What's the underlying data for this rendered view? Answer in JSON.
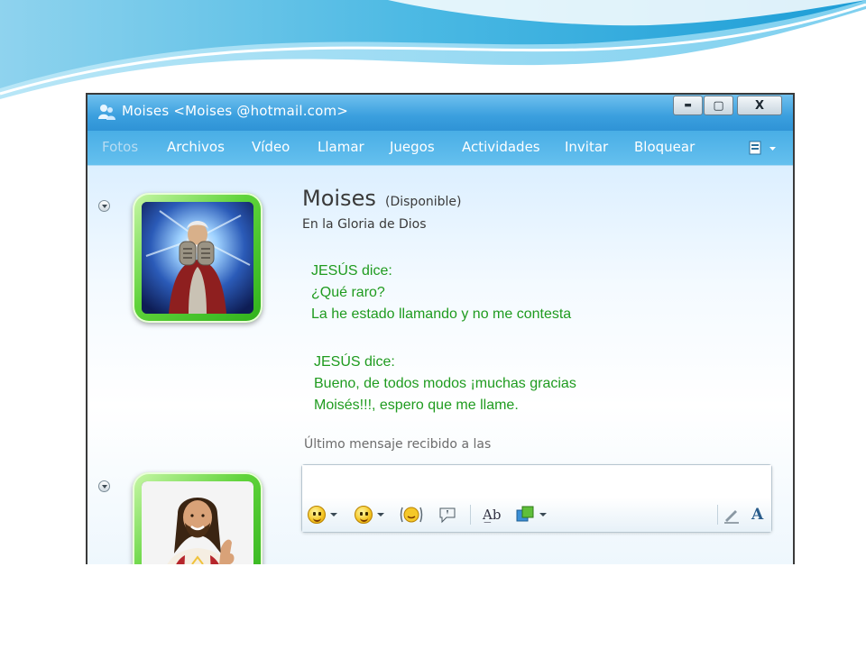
{
  "window": {
    "title": "Moises <Moises @hotmail.com>",
    "controls": {
      "minimize": "▬",
      "maximize": "▢",
      "close": "X"
    }
  },
  "menu": [
    "Fotos",
    "Archivos",
    "Vídeo",
    "Llamar",
    "Juegos",
    "Actividades",
    "Invitar",
    "Bloquear"
  ],
  "contact": {
    "name": "Moises",
    "status": "(Disponible)",
    "personal_message": "En la Gloria de Dios"
  },
  "conversation": [
    {
      "sender_line": "JESÚS dice:",
      "lines": [
        "¿Qué raro?",
        "La he estado llamando y no me contesta"
      ]
    },
    {
      "sender_line": "JESÚS dice:",
      "lines": [
        "Bueno, de todos modos ¡muchas gracias",
        "Moisés!!!, espero que me llame."
      ]
    }
  ],
  "footer": {
    "last_message": "Último mensaje recibido a las"
  },
  "toolbar": {
    "icons": [
      "emoticon-icon",
      "wink-icon",
      "nudge-icon",
      "voice-clip-icon",
      "font-check-icon",
      "background-icon",
      "handwriting-icon",
      "font-icon"
    ],
    "font_label": "A"
  },
  "colors": {
    "titlebar": "#3a9fde",
    "chat_text": "#1f9b1f",
    "avatar_frame": "#5fd33a"
  }
}
